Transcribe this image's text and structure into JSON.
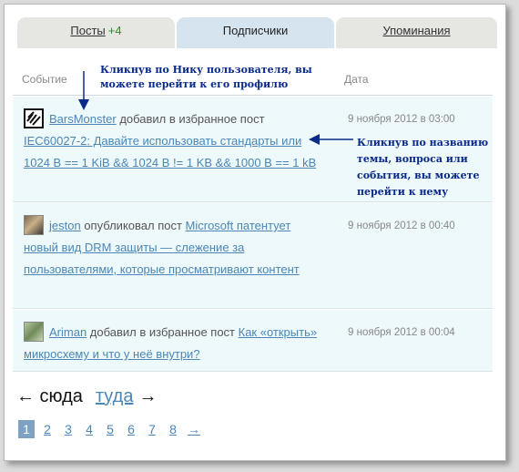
{
  "tabs": [
    {
      "label": "Посты",
      "count": "+4"
    },
    {
      "label": "Подписчики"
    },
    {
      "label": "Упоминания"
    }
  ],
  "table": {
    "col_event": "Событие",
    "col_date": "Дата"
  },
  "rows": [
    {
      "user": "BarsMonster",
      "action": " добавил в избранное пост ",
      "post": "IEC60027-2: Давайте использовать стандарты или 1024 B == 1 KiB && 1024 B != 1 KB && 1000 B == 1 kB",
      "date": "9 ноября 2012 в 03:00"
    },
    {
      "user": "jeston",
      "action": " опубликовал пост ",
      "post": "Microsoft патентует новый вид DRM защиты — слежение за пользователями, которые просматривают контент",
      "date": "9 ноября 2012 в 00:40"
    },
    {
      "user": "Ariman",
      "action": " добавил в избранное пост ",
      "post": "Как «открыть» микросхему и что у неё внутри?",
      "date": "9 ноября 2012 в 00:04"
    }
  ],
  "nav": {
    "prev": "← сюда",
    "next": "туда",
    "next_arrow": "→"
  },
  "pager": {
    "pages": [
      "1",
      "2",
      "3",
      "4",
      "5",
      "6",
      "7",
      "8"
    ],
    "next": "→"
  },
  "annotations": {
    "nick": "Кликнув по Нику пользователя, вы можете перейти к его профилю",
    "title": "Кликнув по названию темы, вопроса или события, вы можете перейти к нему"
  },
  "colors": {
    "link": "#4a86b8",
    "annotation": "#0a2a8a",
    "count": "#2f8b2f"
  }
}
